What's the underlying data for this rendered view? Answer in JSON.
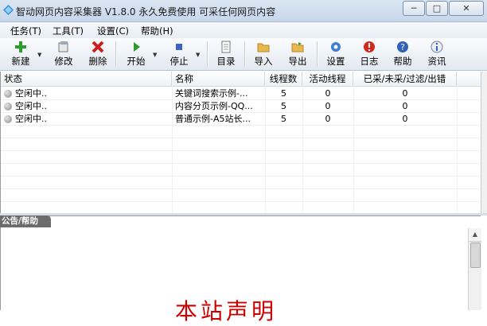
{
  "window": {
    "title": "智动网页内容采集器 V1.8.0 永久免费使用 可采任何网页内容",
    "min_glyph": "─",
    "max_glyph": "□",
    "close_glyph": "✕"
  },
  "menu": [
    "任务(T)",
    "工具(T)",
    "设置(C)",
    "帮助(H)"
  ],
  "toolbar": {
    "new": "新建",
    "edit": "修改",
    "delete": "删除",
    "start": "开始",
    "stop": "停止",
    "catalog": "目录",
    "import": "导入",
    "export": "导出",
    "settings": "设置",
    "log": "日志",
    "help": "帮助",
    "news": "资讯",
    "arrow": "▼"
  },
  "table": {
    "headers": [
      "状态",
      "名称",
      "线程数",
      "活动线程",
      "已采/未采/过滤/出错"
    ],
    "rows": [
      {
        "status": "空闲中..",
        "name": "关键词搜索示例-...",
        "threads": "5",
        "active": "0",
        "stats": "0"
      },
      {
        "status": "空闲中..",
        "name": "内容分页示例-QQ...",
        "threads": "5",
        "active": "0",
        "stats": "0"
      },
      {
        "status": "空闲中..",
        "name": "普通示例-A5站长...",
        "threads": "5",
        "active": "0",
        "stats": "0"
      }
    ]
  },
  "panel": {
    "tab": "公告/帮助",
    "text": "本站声明",
    "scroll_up": "▲"
  },
  "colors": {
    "accent_red": "#cc0000",
    "titlebar": "#c7d7ea"
  }
}
